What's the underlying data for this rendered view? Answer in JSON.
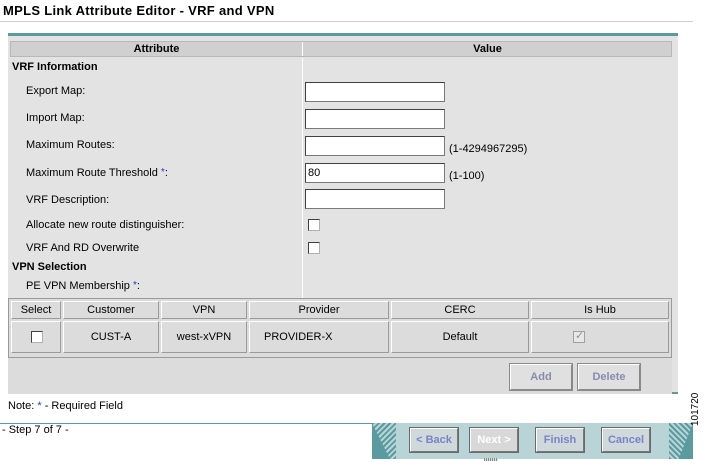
{
  "window": {
    "title": "MPLS Link Attribute Editor - VRF and VPN"
  },
  "table": {
    "headers": {
      "attribute": "Attribute",
      "value": "Value"
    }
  },
  "vrf": {
    "section_label": "VRF Information",
    "export_map": {
      "label": "Export Map:",
      "value": ""
    },
    "import_map": {
      "label": "Import Map:",
      "value": ""
    },
    "max_routes": {
      "label": "Maximum Routes:",
      "value": "",
      "hint": "(1-4294967295)"
    },
    "max_route_threshold": {
      "label": "Maximum Route Threshold ",
      "required_mark": "*",
      "suffix": ":",
      "value": "80",
      "hint": "(1-100)"
    },
    "description": {
      "label": "VRF Description:",
      "value": ""
    },
    "allocate_rd": {
      "label": "Allocate new route distinguisher:",
      "checked": false
    },
    "vrf_rd_overwrite": {
      "label": "VRF And RD Overwrite",
      "checked": false
    }
  },
  "vpn": {
    "section_label": "VPN Selection",
    "membership": {
      "label": "PE VPN Membership ",
      "required_mark": "*",
      "suffix": ":"
    },
    "columns": [
      "Select",
      "Customer",
      "VPN",
      "Provider",
      "CERC",
      "Is Hub"
    ],
    "rows": [
      {
        "select": false,
        "customer": "CUST-A",
        "vpn": "west-xVPN",
        "provider": "PROVIDER-X",
        "cerc": "Default",
        "is_hub": true
      }
    ],
    "add_label": "Add",
    "delete_label": "Delete"
  },
  "note": {
    "prefix": "Note: ",
    "star": "*",
    "text": " - Required Field"
  },
  "footer": {
    "step": "- Step 7 of 7 -",
    "back": "< Back",
    "next": "Next >",
    "finish": "Finish",
    "cancel": "Cancel"
  },
  "side_code": "101720",
  "colors": {
    "accent": "#5a9ba0",
    "required": "#1a3ad0",
    "button_text": "#7a82c8"
  }
}
